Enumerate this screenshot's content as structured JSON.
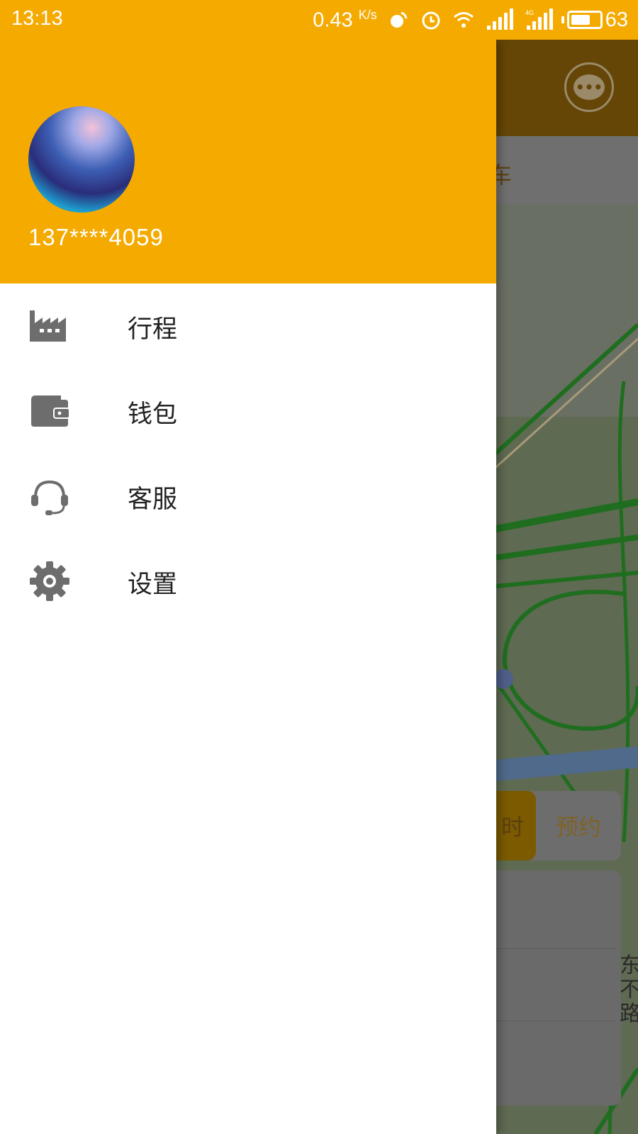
{
  "status_bar": {
    "time": "13:13",
    "speed": "0.43",
    "speed_unit": "K/s",
    "battery_level": "63"
  },
  "drawer": {
    "phone": "137****4059",
    "menu_items": [
      {
        "label": "行程",
        "icon": "factory-icon"
      },
      {
        "label": "钱包",
        "icon": "wallet-icon"
      },
      {
        "label": "客服",
        "icon": "headset-icon"
      },
      {
        "label": "设置",
        "icon": "gear-icon"
      }
    ]
  },
  "background_app": {
    "header_tab_fragment": "车",
    "segment_active_fragment": "时",
    "segment_inactive": "预约",
    "map_label_fragment": "东\n不\n路"
  },
  "colors": {
    "accent": "#f5aa00",
    "drawer_bg": "#ffffff",
    "icon_gray": "#6d6d6d",
    "text_dark": "#222222"
  }
}
